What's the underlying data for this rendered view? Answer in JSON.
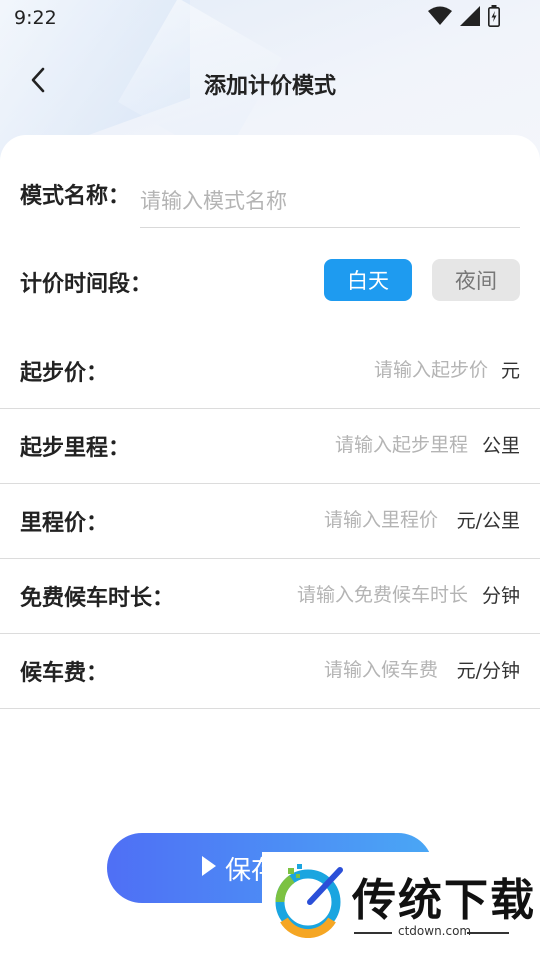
{
  "status": {
    "time": "9:22"
  },
  "nav": {
    "title": "添加计价模式"
  },
  "form": {
    "name_label": "模式名称：",
    "name_placeholder": "请输入模式名称",
    "period_label": "计价时间段：",
    "period_options": [
      "白天",
      "夜间"
    ],
    "period_selected": "白天",
    "rows": [
      {
        "label": "起步价：",
        "placeholder": "请输入起步价",
        "unit": "元"
      },
      {
        "label": "起步里程：",
        "placeholder": "请输入起步里程",
        "unit": "公里"
      },
      {
        "label": "里程价：",
        "placeholder": "请输入里程价",
        "unit": "元/公里"
      },
      {
        "label": "免费候车时长：",
        "placeholder": "请输入免费候车时长",
        "unit": "分钟"
      },
      {
        "label": "候车费：",
        "placeholder": "请输入候车费",
        "unit": "元/分钟"
      }
    ]
  },
  "save_button": {
    "label": "保存"
  },
  "watermark": {
    "text": "传统下载",
    "url": "ctdown.com"
  },
  "colors": {
    "accent": "#1e9bf0",
    "button_start": "#4f6ff5",
    "button_end": "#4aa7f5"
  },
  "icons": {
    "back": "chevron-left-icon",
    "play": "play-icon",
    "wifi": "wifi-icon",
    "signal": "signal-icon",
    "battery": "battery-icon"
  }
}
